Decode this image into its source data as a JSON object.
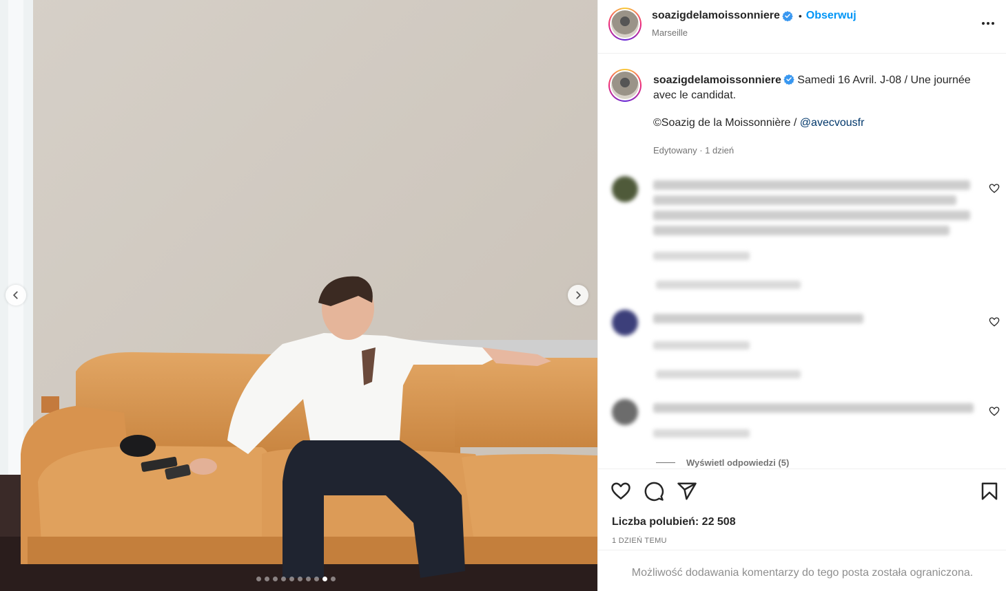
{
  "post": {
    "username": "soazigdelamoissonniere",
    "follow_label": "Obserwuj",
    "separator": "•",
    "location": "Marseille"
  },
  "caption": {
    "username": "soazigdelamoissonniere",
    "text": "Samedi 16 Avril. J-08 / Une journée avec le candidat.",
    "credit_prefix": "©Soazig de la Moissonnière / ",
    "mention": "@avecvousfr",
    "meta": "Edytowany · 1 dzień"
  },
  "comments": {
    "view_replies": "Wyświetl odpowiedzi (5)"
  },
  "actions": {
    "likes": "Liczba polubień: 22 508",
    "time": "1 dzień temu"
  },
  "footer": {
    "restricted": "Możliwość dodawania komentarzy do tego posta została ograniczona."
  },
  "carousel": {
    "slide_count": 10,
    "active_index": 8
  },
  "icons": [
    "chevron-left-icon",
    "chevron-right-icon",
    "verified-icon",
    "more-icon",
    "heart-icon",
    "comment-icon",
    "share-icon",
    "bookmark-icon"
  ],
  "colors": {
    "accent": "#0095f6",
    "mention": "#00376b",
    "muted": "#737373",
    "text": "#262626"
  }
}
